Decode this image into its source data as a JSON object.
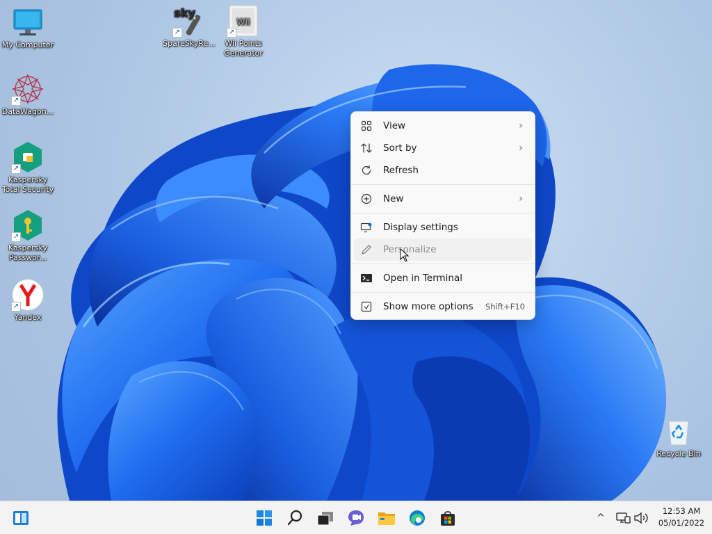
{
  "desktop": {
    "icons": [
      {
        "label": "My Computer",
        "name": "my-computer-icon"
      },
      {
        "label": "SpareSkyRe...",
        "name": "sparesky-icon"
      },
      {
        "label": "Wii Points",
        "label2": "Generator",
        "name": "wii-points-icon",
        "glyph_text": "Wii"
      },
      {
        "label": "DataWagon...",
        "name": "datawagon-icon"
      },
      {
        "label": "Kaspersky",
        "label2": "Total Security",
        "name": "kaspersky-total-security-icon"
      },
      {
        "label": "Kaspersky",
        "label2": "Passwor...",
        "name": "kaspersky-password-icon"
      },
      {
        "label": "Yandex",
        "name": "yandex-icon"
      },
      {
        "label": "Recycle Bin",
        "name": "recycle-bin-icon"
      }
    ],
    "sparesky_glyph_text": "sky"
  },
  "context_menu": {
    "items": [
      {
        "label": "View",
        "icon": "grid-icon",
        "submenu": true
      },
      {
        "label": "Sort by",
        "icon": "sort-icon",
        "submenu": true
      },
      {
        "label": "Refresh",
        "icon": "refresh-icon"
      },
      {
        "label": "New",
        "icon": "plus-circle-icon",
        "submenu": true
      },
      {
        "label": "Display settings",
        "icon": "display-settings-icon"
      },
      {
        "label": "Personalize",
        "icon": "pencil-icon",
        "state": "hovered"
      },
      {
        "label": "Open in Terminal",
        "icon": "terminal-icon"
      },
      {
        "label": "Show more options",
        "icon": "more-options-icon",
        "shortcut": "Shift+F10"
      }
    ],
    "chevron": "›"
  },
  "taskbar": {
    "apps": [
      "widgets-icon",
      "start-icon",
      "search-icon",
      "task-view-icon",
      "chat-icon",
      "file-explorer-icon",
      "edge-icon",
      "store-icon"
    ],
    "tray": {
      "chevron": "^",
      "time": "12:53 AM",
      "date": "05/01/2022"
    }
  }
}
